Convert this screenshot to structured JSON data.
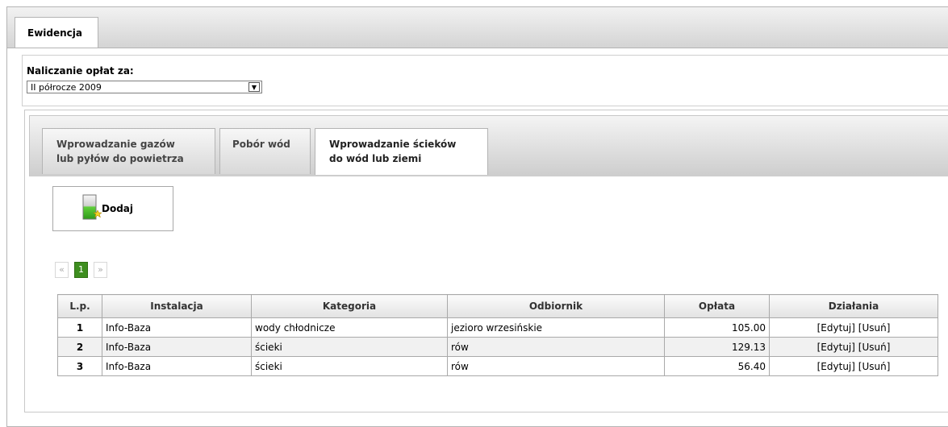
{
  "main_tab": "Ewidencja",
  "period": {
    "label": "Naliczanie opłat za:",
    "selected": "II półrocze 2009"
  },
  "subtabs": [
    {
      "line1": "Wprowadzanie gazów",
      "line2": "lub pyłów do powietrza"
    },
    {
      "line1": "Pobór wód",
      "line2": ""
    },
    {
      "line1": "Wprowadzanie ścieków",
      "line2": "do wód lub ziemi"
    }
  ],
  "active_subtab": 2,
  "add_button": "Dodaj",
  "pager": {
    "prev": "«",
    "current": "1",
    "next": "»"
  },
  "table": {
    "headers": [
      "L.p.",
      "Instalacja",
      "Kategoria",
      "Odbiornik",
      "Opłata",
      "Działania"
    ],
    "rows": [
      {
        "lp": "1",
        "instalacja": "Info-Baza",
        "kategoria": "wody chłodnicze",
        "odbiornik": "jezioro wrzesińskie",
        "oplata": "105.00",
        "edit": "[Edytuj]",
        "del": "[Usuń]"
      },
      {
        "lp": "2",
        "instalacja": "Info-Baza",
        "kategoria": "ścieki",
        "odbiornik": "rów",
        "oplata": "129.13",
        "edit": "[Edytuj]",
        "del": "[Usuń]"
      },
      {
        "lp": "3",
        "instalacja": "Info-Baza",
        "kategoria": "ścieki",
        "odbiornik": "rów",
        "oplata": "56.40",
        "edit": "[Edytuj]",
        "del": "[Usuń]"
      }
    ]
  },
  "colors": {
    "pager_active": "#3e8e1f"
  }
}
